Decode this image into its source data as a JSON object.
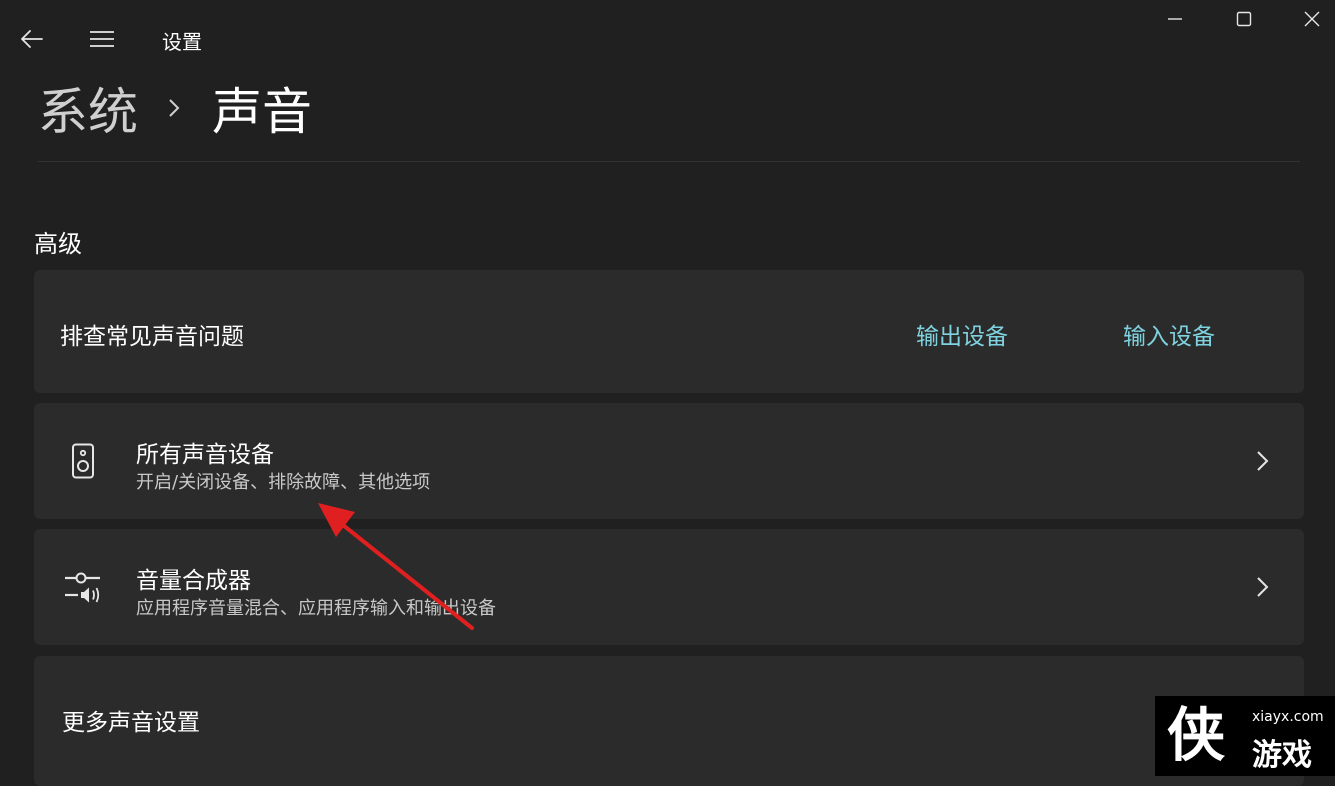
{
  "window": {
    "title": "设置"
  },
  "breadcrumb": {
    "parent": "系统",
    "current": "声音"
  },
  "section": {
    "heading": "高级"
  },
  "troubleshoot": {
    "title": "排查常见声音问题",
    "output_link": "输出设备",
    "input_link": "输入设备"
  },
  "all_devices": {
    "title": "所有声音设备",
    "subtitle": "开启/关闭设备、排除故障、其他选项"
  },
  "mixer": {
    "title": "音量合成器",
    "subtitle": "应用程序音量混合、应用程序输入和输出设备"
  },
  "more_settings": {
    "title": "更多声音设置"
  },
  "watermark": {
    "site": "xiayx.com",
    "name": "游戏",
    "logo_char": "侠"
  },
  "colors": {
    "background": "#202020",
    "card": "#2b2b2b",
    "link": "#7fd3e0",
    "annotation_arrow": "#e02020"
  }
}
